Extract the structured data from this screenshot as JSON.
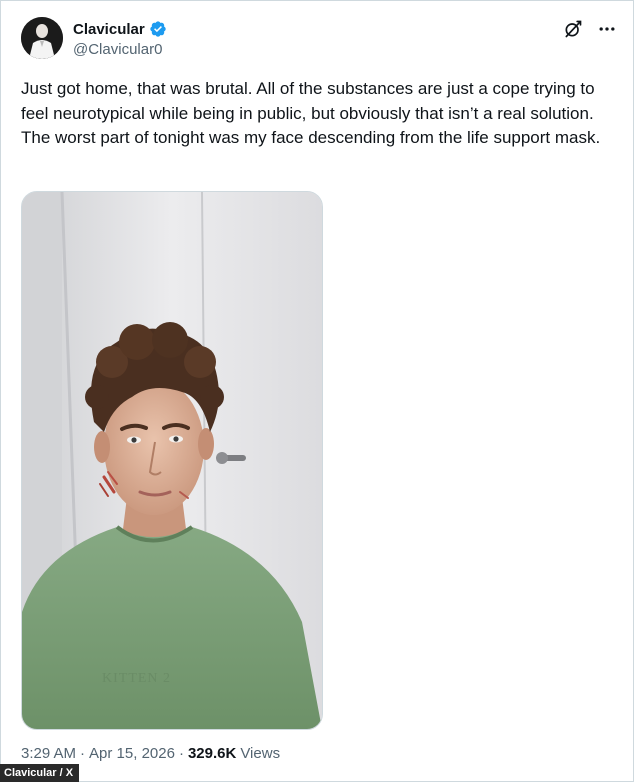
{
  "author": {
    "display_name": "Clavicular",
    "handle": "@Clavicular0",
    "verified": true,
    "avatar_icon": "person-avatar"
  },
  "actions": {
    "grok_icon": "grok-icon",
    "more_icon": "more-icon"
  },
  "tweet": {
    "text": "Just got home, that was brutal. All of the substances are just a cope trying to feel neurotypical while being in public, but obviously that isn’t a real solution. The worst part of tonight was my face descending from the life support mask."
  },
  "meta": {
    "time": "3:29 AM",
    "separator": "·",
    "date": "Apr 15, 2026",
    "views_count": "329.6K",
    "views_label": "Views"
  },
  "credit": {
    "text": "Clavicular / X"
  },
  "colors": {
    "text_primary": "#0f1419",
    "text_secondary": "#536471",
    "verified_blue": "#1d9bf0",
    "border": "#cfd9de",
    "shirt_green": "#7fa37a"
  }
}
